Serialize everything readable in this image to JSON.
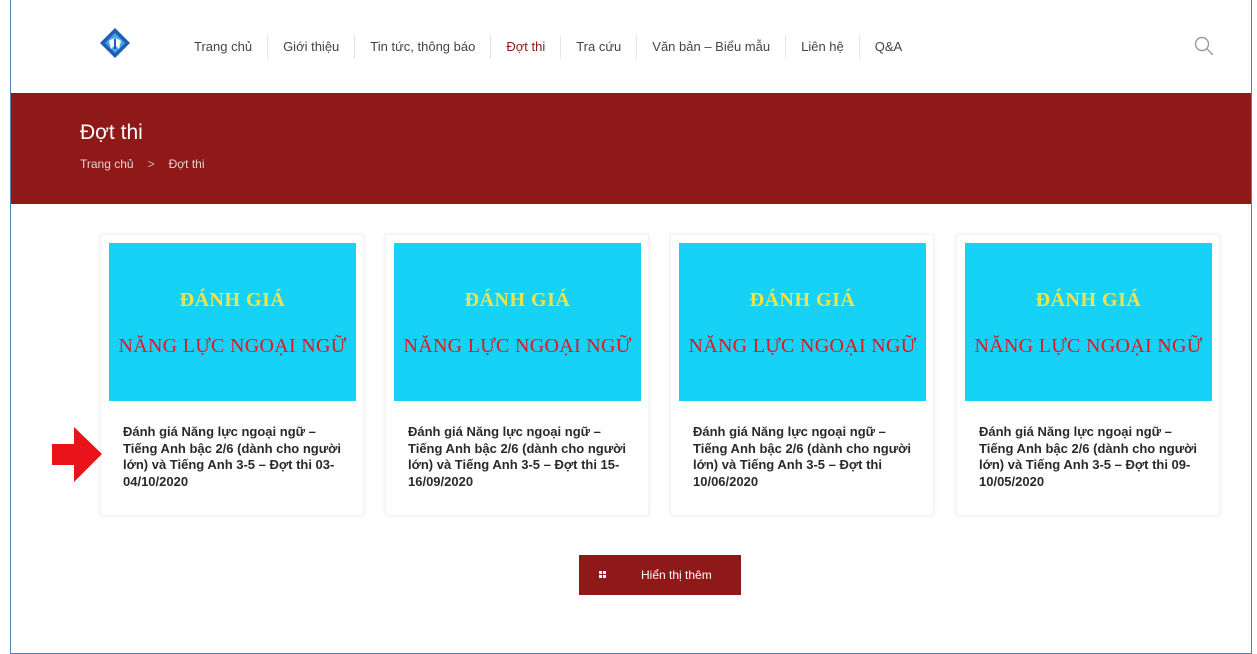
{
  "nav": {
    "items": [
      {
        "label": "Trang chủ"
      },
      {
        "label": "Giới thiệu"
      },
      {
        "label": "Tin tức, thông báo"
      },
      {
        "label": "Đợt thi"
      },
      {
        "label": "Tra cứu"
      },
      {
        "label": "Văn bản – Biểu mẫu"
      },
      {
        "label": "Liên hệ"
      },
      {
        "label": "Q&A"
      }
    ],
    "active_index": 3
  },
  "banner": {
    "title": "Đợt thi",
    "breadcrumb": [
      "Trang chủ",
      "Đợt thi"
    ],
    "separator": ">"
  },
  "cards": [
    {
      "thumb_line1": "ĐÁNH GIÁ",
      "thumb_line2": "NĂNG LỰC NGOẠI NGỮ",
      "title": "Đánh giá Năng lực ngoại ngữ – Tiếng Anh bậc 2/6 (dành cho người lớn) và Tiếng Anh 3-5 – Đợt thi 03-04/10/2020"
    },
    {
      "thumb_line1": "ĐÁNH GIÁ",
      "thumb_line2": "NĂNG LỰC NGOẠI NGỮ",
      "title": "Đánh giá Năng lực ngoại ngữ – Tiếng Anh bậc 2/6 (dành cho người lớn) và Tiếng Anh 3-5 – Đợt thi 15-16/09/2020"
    },
    {
      "thumb_line1": "ĐÁNH GIÁ",
      "thumb_line2": "NĂNG LỰC NGOẠI NGỮ",
      "title": "Đánh giá Năng lực ngoại ngữ – Tiếng Anh bậc 2/6 (dành cho người lớn) và Tiếng Anh 3-5 – Đợt thi 10/06/2020"
    },
    {
      "thumb_line1": "ĐÁNH GIÁ",
      "thumb_line2": "NĂNG LỰC NGOẠI NGỮ",
      "title": "Đánh giá Năng lực ngoại ngữ – Tiếng Anh bậc 2/6 (dành cho người lớn) và Tiếng Anh 3-5 – Đợt thi 09-10/05/2020"
    }
  ],
  "load_more": {
    "label": "Hiển thị thêm",
    "icon": "grid-icon"
  },
  "icons": {
    "search": "search-icon",
    "logo": "logo-icon",
    "annotation": "red-arrow-icon"
  },
  "colors": {
    "brand": "#8f1919",
    "thumb_bg": "#17d2f7",
    "thumb_line1": "#f2e24a",
    "thumb_line2": "#e0171c",
    "arrow": "#e8141a"
  }
}
